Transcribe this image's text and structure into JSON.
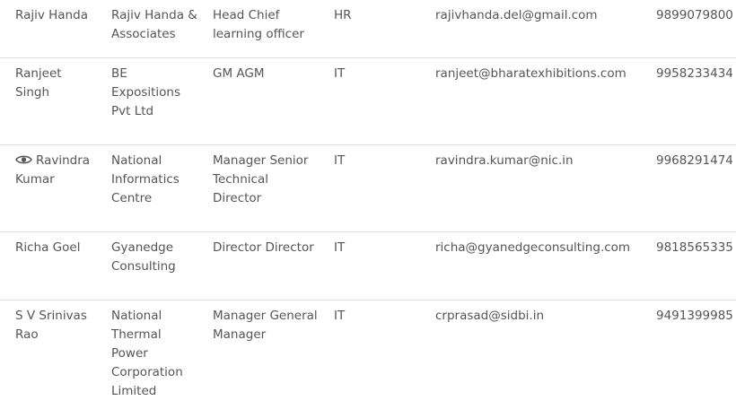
{
  "contacts": {
    "rows": [
      {
        "name": "Rajiv Handa",
        "company": "Rajiv Handa & Associates",
        "designation": "Head Chief learning officer",
        "department": "HR",
        "email": "rajivhanda.del@gmail.com",
        "phone": "9899079800"
      },
      {
        "name": "Ranjeet Singh",
        "company": "BE Expositions Pvt Ltd",
        "designation": "GM AGM",
        "department": "IT",
        "email": "ranjeet@bharatexhibitions.com",
        "phone": "9958233434"
      },
      {
        "name": "Ravindra Kumar",
        "company": "National Informatics Centre",
        "designation": "Manager Senior Technical Director",
        "department": "IT",
        "email": "ravindra.kumar@nic.in",
        "phone": "9968291474",
        "icon": "eye-icon"
      },
      {
        "name": "Richa Goel",
        "company": "Gyanedge Consulting",
        "designation": "Director Director",
        "department": "IT",
        "email": "richa@gyanedgeconsulting.com",
        "phone": "9818565335"
      },
      {
        "name": "S V Srinivas Rao",
        "company": "National Thermal Power Corporation Limited",
        "designation": "Manager General Manager",
        "department": "IT",
        "email": "crprasad@sidbi.in",
        "phone": "9491399985"
      }
    ]
  },
  "colors": {
    "text": "#555555",
    "divider": "#dddddd",
    "background": "#ffffff"
  }
}
